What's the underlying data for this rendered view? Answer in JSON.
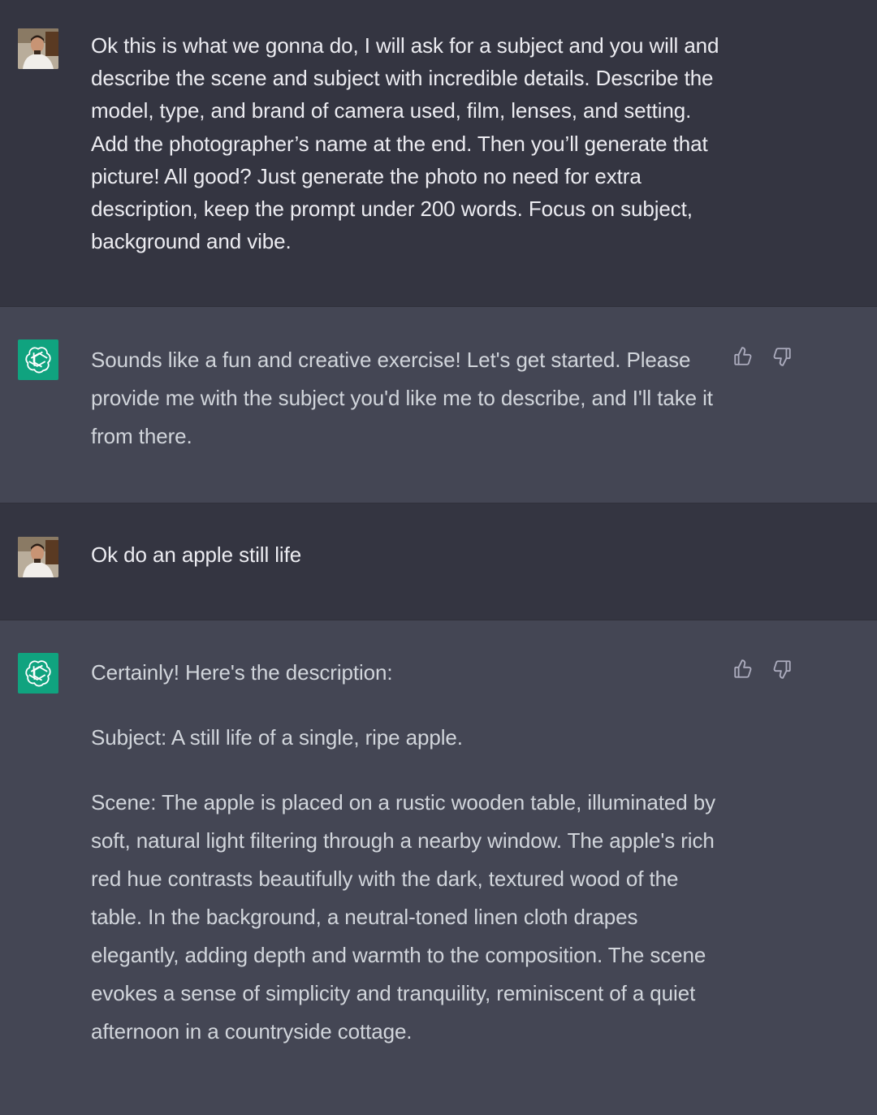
{
  "messages": [
    {
      "role": "user",
      "avatar_icon": "user-avatar",
      "paragraphs": [
        "Ok this is what we gonna do, I will ask for a subject and you will and describe the scene and subject with incredible details. Describe the model, type, and brand of camera used, film, lenses, and setting.  Add the photographer’s name at the end. Then you’ll generate that picture! All good? Just generate the photo no need for extra description, keep the prompt under 200 words. Focus on subject, background and vibe."
      ]
    },
    {
      "role": "assistant",
      "avatar_icon": "openai-logo-icon",
      "paragraphs": [
        "Sounds like a fun and creative exercise! Let's get started. Please provide me with the subject you'd like me to describe, and I'll take it from there."
      ]
    },
    {
      "role": "user",
      "avatar_icon": "user-avatar",
      "paragraphs": [
        "Ok do an apple still life"
      ]
    },
    {
      "role": "assistant",
      "avatar_icon": "openai-logo-icon",
      "paragraphs": [
        "Certainly! Here's the description:",
        "Subject: A still life of a single, ripe apple.",
        "Scene: The apple is placed on a rustic wooden table, illuminated by soft, natural light filtering through a nearby window. The apple's rich red hue contrasts beautifully with the dark, textured wood of the table. In the background, a neutral-toned linen cloth drapes elegantly, adding depth and warmth to the composition. The scene evokes a sense of simplicity and tranquility, reminiscent of a quiet afternoon in a countryside cottage."
      ]
    }
  ],
  "icons": {
    "thumbs_up": "thumbs-up-icon",
    "thumbs_down": "thumbs-down-icon"
  },
  "colors": {
    "user_bg": "#343541",
    "assistant_bg": "#444654",
    "brand_green": "#10a37f"
  }
}
